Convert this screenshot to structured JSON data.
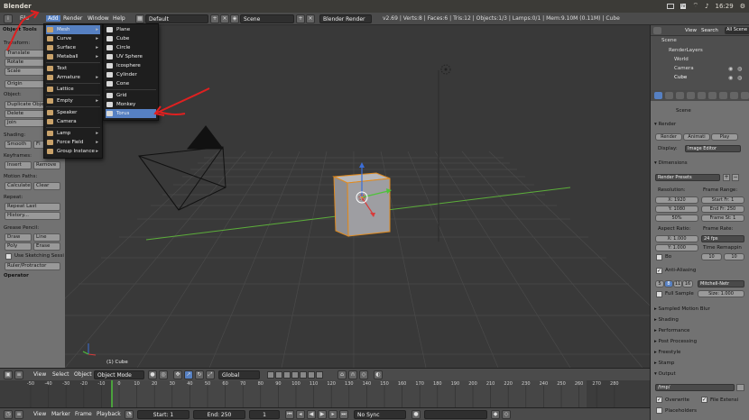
{
  "window": {
    "title": "Blender",
    "clock": "16:29",
    "tray_icons": [
      "envelope-icon",
      "lv-icon",
      "wifi-icon",
      "speaker-icon"
    ],
    "tray_lv": "lv"
  },
  "infobar": {
    "menus": [
      "File",
      "Add",
      "Render",
      "Window",
      "Help"
    ],
    "layout": "Default",
    "scene": "Scene",
    "engine": "Blender Render",
    "stats": "v2.69 | Verts:8 | Faces:6 | Tris:12 | Objects:1/3 | Lamps:0/1 | Mem:9.10M (0.11M) | Cube"
  },
  "add_menu": {
    "items": [
      {
        "label": "Mesh",
        "icon": "mesh-icon",
        "submenu": true,
        "highlight": true
      },
      {
        "label": "Curve",
        "icon": "curve-icon",
        "submenu": true
      },
      {
        "label": "Surface",
        "icon": "surface-icon",
        "submenu": true
      },
      {
        "label": "Metaball",
        "icon": "metaball-icon",
        "submenu": true
      },
      {
        "label": "Text",
        "icon": "text-icon",
        "submenu": false
      },
      {
        "label": "Armature",
        "icon": "armature-icon",
        "submenu": true
      },
      {
        "label": "Lattice",
        "icon": "lattice-icon",
        "submenu": false
      },
      {
        "label": "Empty",
        "icon": "empty-icon",
        "submenu": true
      },
      {
        "label": "Speaker",
        "icon": "speaker-icon",
        "submenu": false
      },
      {
        "label": "Camera",
        "icon": "camera-icon",
        "submenu": false
      },
      {
        "label": "Lamp",
        "icon": "lamp-icon",
        "submenu": true
      },
      {
        "label": "Force Field",
        "icon": "force-field-icon",
        "submenu": true
      },
      {
        "label": "Group Instance",
        "icon": "group-instance-icon",
        "submenu": true
      }
    ]
  },
  "mesh_menu": {
    "items": [
      {
        "label": "Plane",
        "icon": "plane-icon"
      },
      {
        "label": "Cube",
        "icon": "cube-icon"
      },
      {
        "label": "Circle",
        "icon": "circle-icon"
      },
      {
        "label": "UV Sphere",
        "icon": "uv-sphere-icon"
      },
      {
        "label": "Icosphere",
        "icon": "icosphere-icon"
      },
      {
        "label": "Cylinder",
        "icon": "cylinder-icon"
      },
      {
        "label": "Cone",
        "icon": "cone-icon"
      },
      {
        "label": "Grid",
        "icon": "grid-icon"
      },
      {
        "label": "Monkey",
        "icon": "monkey-icon"
      },
      {
        "label": "Torus",
        "icon": "torus-icon",
        "highlight": true
      }
    ]
  },
  "toolshelf": {
    "header": "Object Tools",
    "transform_label": "Transform:",
    "translate": "Translate",
    "rotate": "Rotate",
    "scale": "Scale",
    "origin": "Origin",
    "object_label": "Object:",
    "duplicate": "Duplicate Obje",
    "delete": "Delete",
    "join": "Join",
    "shading_label": "Shading:",
    "smooth": "Smooth",
    "flat": "Fl",
    "keyframes_label": "Keyframes:",
    "insert": "Insert",
    "remove": "Remove",
    "motion_label": "Motion Paths:",
    "calculate": "Calculate",
    "clear": "Clear",
    "repeat_label": "Repeat:",
    "repeat_last": "Repeat Last",
    "history": "History...",
    "grease_label": "Grease Pencil:",
    "draw": "Draw",
    "line": "Line",
    "poly": "Poly",
    "erase": "Erase",
    "sketch": "Use Sketching Sessi",
    "ruler": "Ruler/Protractor",
    "operator": "Operator"
  },
  "viewport": {
    "object_label": "(1) Cube"
  },
  "outliner": {
    "view": "View",
    "search": "Search",
    "scenes": "All Scene",
    "items": [
      "Scene",
      "RenderLayers",
      "World",
      "Camera",
      "Cube"
    ]
  },
  "props": {
    "scene": "Scene",
    "render_header": "Render",
    "render_btn": "Render",
    "anim_btn": "Animati",
    "play_btn": "Play",
    "display_label": "Display:",
    "display_value": "Image Editor",
    "dimensions": "Dimensions",
    "presets": "Render Presets",
    "resolution": "Resolution:",
    "frame_range": "Frame Range:",
    "x_res": "X: 1920",
    "start": "Start Fr: 1",
    "y_res": "Y: 1080",
    "end": "End Fr: 250",
    "percent": "50%",
    "frame_step": "Frame St: 1",
    "aspect": "Aspect Ratio:",
    "frame_rate": "Frame Rate:",
    "ax": "X: 1.000",
    "fps": "24 fps",
    "ay": "Y: 1.000",
    "time_remap": "Time Remappin",
    "bo": "Bo",
    "r10a": "10",
    "r10b": "10",
    "aa": "Anti-Aliasing",
    "s5": "5",
    "s8": "8",
    "s11": "11",
    "s16": "16",
    "filter": "Mitchell-Netr",
    "full_sample": "Full Sample",
    "size": "Size: 1.000",
    "sampled_mb": "Sampled Motion Blur",
    "shading": "Shading",
    "performance": "Performance",
    "post": "Post Processing",
    "freestyle": "Freestyle",
    "stamp": "Stamp",
    "output": "Output",
    "path": "/tmp/",
    "overwrite": "Overwrite",
    "file_ext": "File Extensi",
    "placeholders": "Placeholders"
  },
  "view3d_header": {
    "view": "View",
    "select": "Select",
    "object": "Object",
    "mode": "Object Mode",
    "orientation": "Global"
  },
  "timeline": {
    "ticks": [
      "-50",
      "-40",
      "-30",
      "-20",
      "-10",
      "0",
      "10",
      "20",
      "30",
      "40",
      "50",
      "60",
      "70",
      "80",
      "90",
      "100",
      "110",
      "120",
      "130",
      "140",
      "150",
      "160",
      "170",
      "180",
      "190",
      "200",
      "210",
      "220",
      "230",
      "240",
      "250",
      "260",
      "270",
      "280"
    ],
    "view": "View",
    "marker": "Marker",
    "frame": "Frame",
    "playback": "Playback",
    "start": "Start: 1",
    "end": "End: 250",
    "current": "1",
    "sync": "No Sync"
  }
}
